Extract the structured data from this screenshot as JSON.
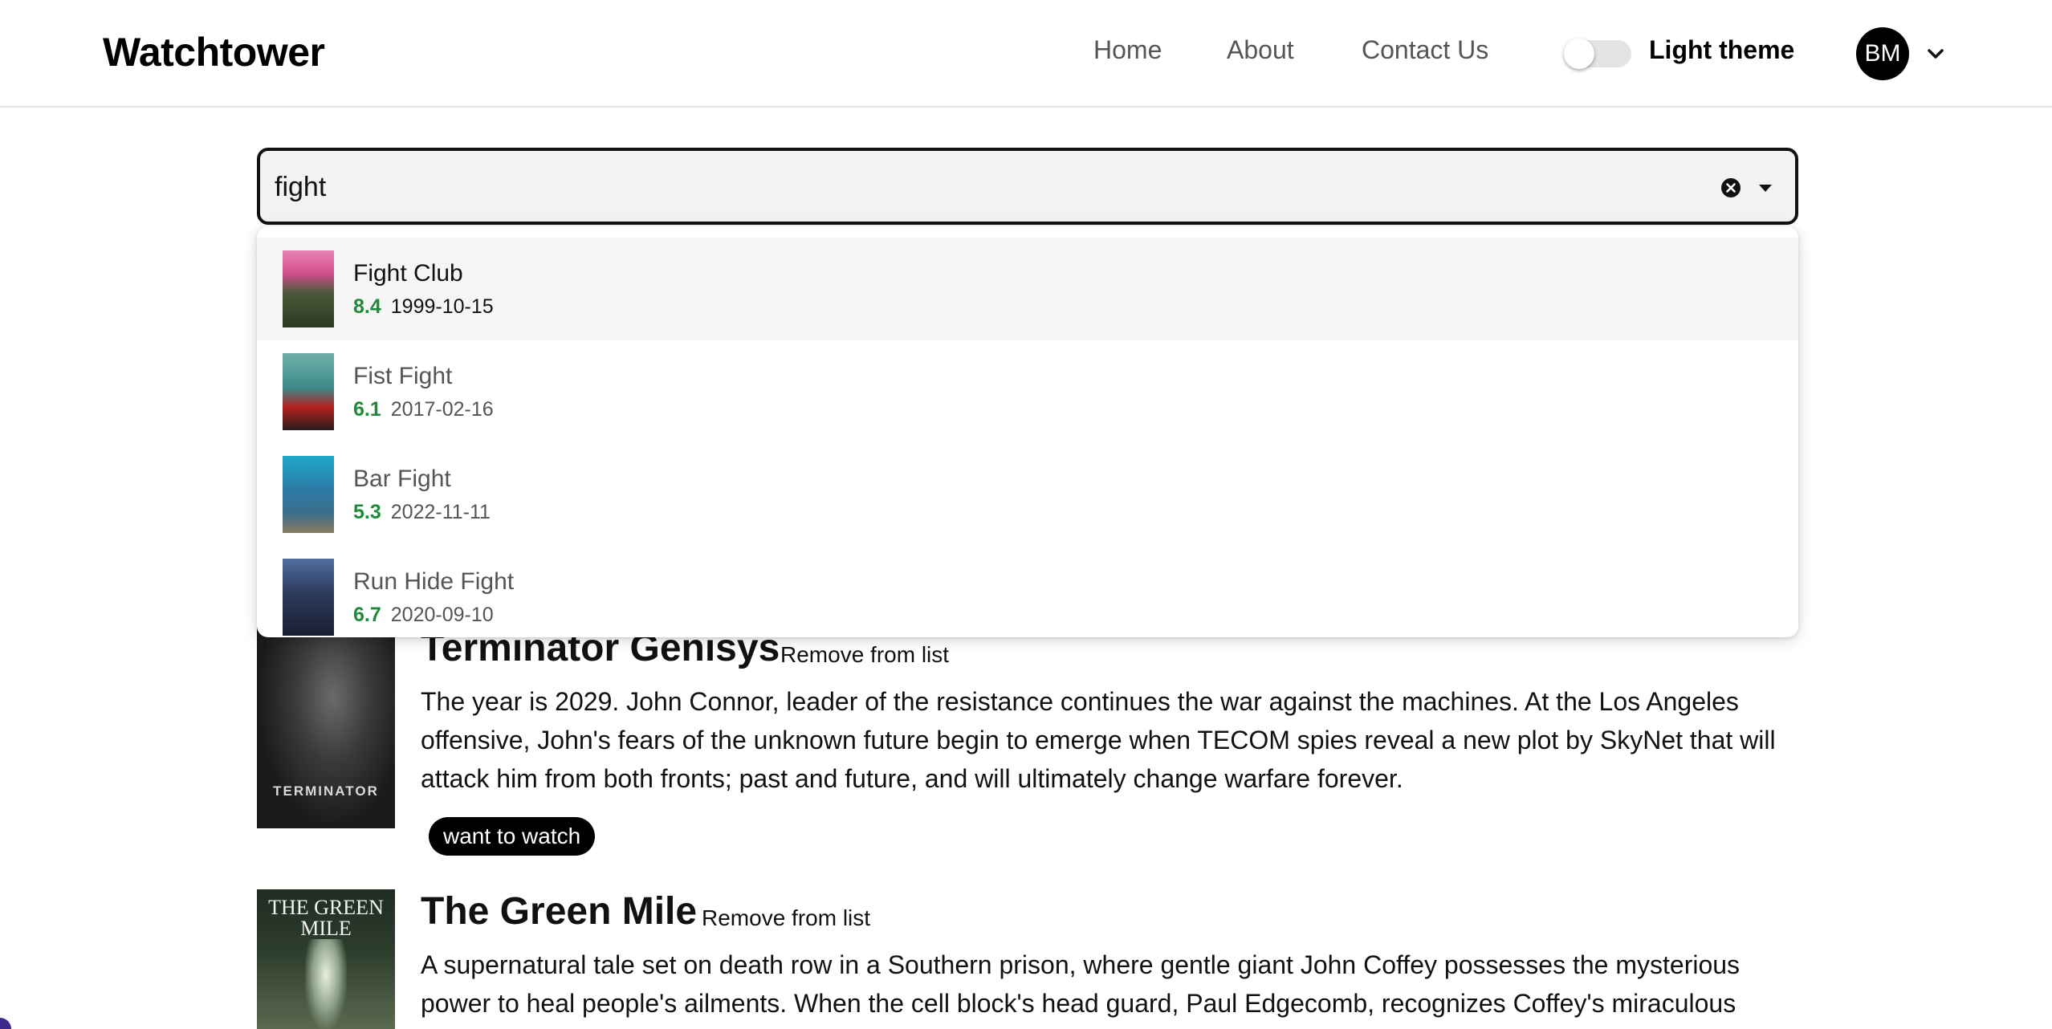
{
  "header": {
    "brand": "Watchtower",
    "nav": [
      {
        "label": "Home"
      },
      {
        "label": "About"
      },
      {
        "label": "Contact Us"
      }
    ],
    "theme_toggle": {
      "label": "Light theme",
      "checked": false
    },
    "avatar_initials": "BM"
  },
  "search": {
    "value": "fight",
    "placeholder": ""
  },
  "suggestions": [
    {
      "title": "Fight Club",
      "rating": "8.4",
      "date": "1999-10-15",
      "highlighted": true
    },
    {
      "title": "Fist Fight",
      "rating": "6.1",
      "date": "2017-02-16",
      "highlighted": false
    },
    {
      "title": "Bar Fight",
      "rating": "5.3",
      "date": "2022-11-11",
      "highlighted": false
    },
    {
      "title": "Run Hide Fight",
      "rating": "6.7",
      "date": "2020-09-10",
      "highlighted": false
    }
  ],
  "results": [
    {
      "title": "Terminator Genisys",
      "remove_label": "Remove from list",
      "description": "The year is 2029. John Connor, leader of the resistance continues the war against the machines. At the Los Angeles offensive, John's fears of the unknown future begin to emerge when TECOM spies reveal a new plot by SkyNet that will attack him from both fronts; past and future, and will ultimately change warfare forever.",
      "tag": "want to watch",
      "poster_text": "TERMINATOR"
    },
    {
      "title": "The Green Mile",
      "remove_label": "Remove from list",
      "description": "A supernatural tale set on death row in a Southern prison, where gentle giant John Coffey possesses the mysterious power to heal people's ailments. When the cell block's head guard, Paul Edgecomb, recognizes Coffey's miraculous",
      "poster_text": "THE GREEN MILE"
    }
  ],
  "colors": {
    "rating_green": "#1f8a3a",
    "accent_black": "#000000",
    "search_bg": "#f2f2f2"
  },
  "icons": {
    "clear": "clear-circle-icon",
    "dropdown": "caret-down-icon",
    "avatar_menu": "chevron-down-icon"
  }
}
